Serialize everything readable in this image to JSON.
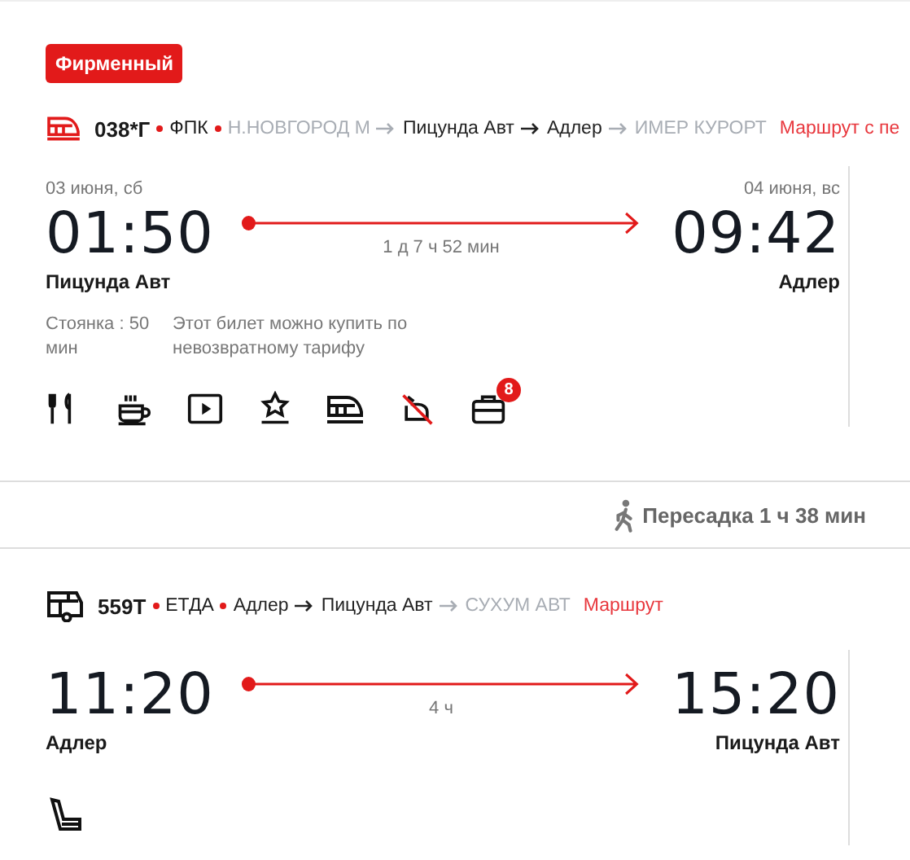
{
  "segments": [
    {
      "kind": "train",
      "badge": "Фирменный",
      "number": "038*Г",
      "carrier": "ФПК",
      "stations": [
        {
          "name": "Н.НОВГОРОД М",
          "in_trip": false
        },
        {
          "name": "Пицунда Авт",
          "in_trip": true
        },
        {
          "name": "Адлер",
          "in_trip": true
        },
        {
          "name": "ИМЕР КУРОРТ",
          "in_trip": false
        }
      ],
      "route_link": "Маршрут с пе",
      "departure": {
        "date": "03 июня, сб",
        "time": "01:50",
        "station": "Пицунда Авт"
      },
      "arrival": {
        "date": "04 июня, вс",
        "time": "09:42",
        "station": "Адлер"
      },
      "duration": "1 д 7 ч 52 мин",
      "notes": [
        "Стоянка : 50 мин",
        "Этот билет можно купить по невозвратному тарифу"
      ],
      "amenities": [
        {
          "kind": "food"
        },
        {
          "kind": "coffee"
        },
        {
          "kind": "video"
        },
        {
          "kind": "premium"
        },
        {
          "kind": "train"
        },
        {
          "kind": "no-pets"
        },
        {
          "kind": "luggage",
          "count": "8"
        }
      ]
    },
    {
      "kind": "bus",
      "number": "559Т",
      "carrier": "ЕТДА",
      "stations": [
        {
          "name": "Адлер",
          "in_trip": true
        },
        {
          "name": "Пицунда Авт",
          "in_trip": true
        },
        {
          "name": "СУХУМ АВТ",
          "in_trip": false
        }
      ],
      "route_link": "Маршрут",
      "departure": {
        "time": "11:20",
        "station": "Адлер"
      },
      "arrival": {
        "time": "15:20",
        "station": "Пицунда Авт"
      },
      "duration": "4 ч",
      "amenities": [
        {
          "kind": "seat"
        }
      ]
    }
  ],
  "transfer": "Пересадка 1 ч 38 мин"
}
